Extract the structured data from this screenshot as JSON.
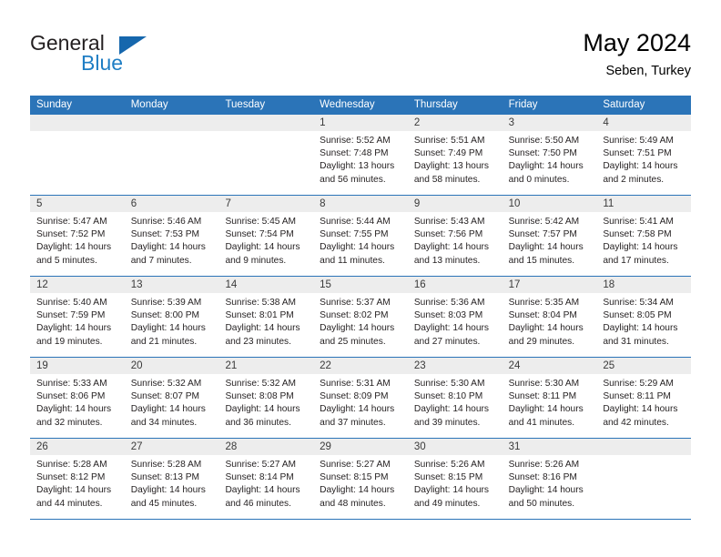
{
  "brand": {
    "word1": "General",
    "word2": "Blue",
    "logo_icon": "triangle-logo-icon",
    "accent_color": "#1f7ec4"
  },
  "header": {
    "title": "May 2024",
    "subtitle": "Seben, Turkey"
  },
  "theme": {
    "header_blue": "#2b74b8",
    "day_number_band": "#ededed",
    "text": "#231f20"
  },
  "weekdays": [
    "Sunday",
    "Monday",
    "Tuesday",
    "Wednesday",
    "Thursday",
    "Friday",
    "Saturday"
  ],
  "weeks": [
    [
      {
        "day": "",
        "sunrise": "",
        "sunset": "",
        "daylight1": "",
        "daylight2": ""
      },
      {
        "day": "",
        "sunrise": "",
        "sunset": "",
        "daylight1": "",
        "daylight2": ""
      },
      {
        "day": "",
        "sunrise": "",
        "sunset": "",
        "daylight1": "",
        "daylight2": ""
      },
      {
        "day": "1",
        "sunrise": "Sunrise: 5:52 AM",
        "sunset": "Sunset: 7:48 PM",
        "daylight1": "Daylight: 13 hours",
        "daylight2": "and 56 minutes."
      },
      {
        "day": "2",
        "sunrise": "Sunrise: 5:51 AM",
        "sunset": "Sunset: 7:49 PM",
        "daylight1": "Daylight: 13 hours",
        "daylight2": "and 58 minutes."
      },
      {
        "day": "3",
        "sunrise": "Sunrise: 5:50 AM",
        "sunset": "Sunset: 7:50 PM",
        "daylight1": "Daylight: 14 hours",
        "daylight2": "and 0 minutes."
      },
      {
        "day": "4",
        "sunrise": "Sunrise: 5:49 AM",
        "sunset": "Sunset: 7:51 PM",
        "daylight1": "Daylight: 14 hours",
        "daylight2": "and 2 minutes."
      }
    ],
    [
      {
        "day": "5",
        "sunrise": "Sunrise: 5:47 AM",
        "sunset": "Sunset: 7:52 PM",
        "daylight1": "Daylight: 14 hours",
        "daylight2": "and 5 minutes."
      },
      {
        "day": "6",
        "sunrise": "Sunrise: 5:46 AM",
        "sunset": "Sunset: 7:53 PM",
        "daylight1": "Daylight: 14 hours",
        "daylight2": "and 7 minutes."
      },
      {
        "day": "7",
        "sunrise": "Sunrise: 5:45 AM",
        "sunset": "Sunset: 7:54 PM",
        "daylight1": "Daylight: 14 hours",
        "daylight2": "and 9 minutes."
      },
      {
        "day": "8",
        "sunrise": "Sunrise: 5:44 AM",
        "sunset": "Sunset: 7:55 PM",
        "daylight1": "Daylight: 14 hours",
        "daylight2": "and 11 minutes."
      },
      {
        "day": "9",
        "sunrise": "Sunrise: 5:43 AM",
        "sunset": "Sunset: 7:56 PM",
        "daylight1": "Daylight: 14 hours",
        "daylight2": "and 13 minutes."
      },
      {
        "day": "10",
        "sunrise": "Sunrise: 5:42 AM",
        "sunset": "Sunset: 7:57 PM",
        "daylight1": "Daylight: 14 hours",
        "daylight2": "and 15 minutes."
      },
      {
        "day": "11",
        "sunrise": "Sunrise: 5:41 AM",
        "sunset": "Sunset: 7:58 PM",
        "daylight1": "Daylight: 14 hours",
        "daylight2": "and 17 minutes."
      }
    ],
    [
      {
        "day": "12",
        "sunrise": "Sunrise: 5:40 AM",
        "sunset": "Sunset: 7:59 PM",
        "daylight1": "Daylight: 14 hours",
        "daylight2": "and 19 minutes."
      },
      {
        "day": "13",
        "sunrise": "Sunrise: 5:39 AM",
        "sunset": "Sunset: 8:00 PM",
        "daylight1": "Daylight: 14 hours",
        "daylight2": "and 21 minutes."
      },
      {
        "day": "14",
        "sunrise": "Sunrise: 5:38 AM",
        "sunset": "Sunset: 8:01 PM",
        "daylight1": "Daylight: 14 hours",
        "daylight2": "and 23 minutes."
      },
      {
        "day": "15",
        "sunrise": "Sunrise: 5:37 AM",
        "sunset": "Sunset: 8:02 PM",
        "daylight1": "Daylight: 14 hours",
        "daylight2": "and 25 minutes."
      },
      {
        "day": "16",
        "sunrise": "Sunrise: 5:36 AM",
        "sunset": "Sunset: 8:03 PM",
        "daylight1": "Daylight: 14 hours",
        "daylight2": "and 27 minutes."
      },
      {
        "day": "17",
        "sunrise": "Sunrise: 5:35 AM",
        "sunset": "Sunset: 8:04 PM",
        "daylight1": "Daylight: 14 hours",
        "daylight2": "and 29 minutes."
      },
      {
        "day": "18",
        "sunrise": "Sunrise: 5:34 AM",
        "sunset": "Sunset: 8:05 PM",
        "daylight1": "Daylight: 14 hours",
        "daylight2": "and 31 minutes."
      }
    ],
    [
      {
        "day": "19",
        "sunrise": "Sunrise: 5:33 AM",
        "sunset": "Sunset: 8:06 PM",
        "daylight1": "Daylight: 14 hours",
        "daylight2": "and 32 minutes."
      },
      {
        "day": "20",
        "sunrise": "Sunrise: 5:32 AM",
        "sunset": "Sunset: 8:07 PM",
        "daylight1": "Daylight: 14 hours",
        "daylight2": "and 34 minutes."
      },
      {
        "day": "21",
        "sunrise": "Sunrise: 5:32 AM",
        "sunset": "Sunset: 8:08 PM",
        "daylight1": "Daylight: 14 hours",
        "daylight2": "and 36 minutes."
      },
      {
        "day": "22",
        "sunrise": "Sunrise: 5:31 AM",
        "sunset": "Sunset: 8:09 PM",
        "daylight1": "Daylight: 14 hours",
        "daylight2": "and 37 minutes."
      },
      {
        "day": "23",
        "sunrise": "Sunrise: 5:30 AM",
        "sunset": "Sunset: 8:10 PM",
        "daylight1": "Daylight: 14 hours",
        "daylight2": "and 39 minutes."
      },
      {
        "day": "24",
        "sunrise": "Sunrise: 5:30 AM",
        "sunset": "Sunset: 8:11 PM",
        "daylight1": "Daylight: 14 hours",
        "daylight2": "and 41 minutes."
      },
      {
        "day": "25",
        "sunrise": "Sunrise: 5:29 AM",
        "sunset": "Sunset: 8:11 PM",
        "daylight1": "Daylight: 14 hours",
        "daylight2": "and 42 minutes."
      }
    ],
    [
      {
        "day": "26",
        "sunrise": "Sunrise: 5:28 AM",
        "sunset": "Sunset: 8:12 PM",
        "daylight1": "Daylight: 14 hours",
        "daylight2": "and 44 minutes."
      },
      {
        "day": "27",
        "sunrise": "Sunrise: 5:28 AM",
        "sunset": "Sunset: 8:13 PM",
        "daylight1": "Daylight: 14 hours",
        "daylight2": "and 45 minutes."
      },
      {
        "day": "28",
        "sunrise": "Sunrise: 5:27 AM",
        "sunset": "Sunset: 8:14 PM",
        "daylight1": "Daylight: 14 hours",
        "daylight2": "and 46 minutes."
      },
      {
        "day": "29",
        "sunrise": "Sunrise: 5:27 AM",
        "sunset": "Sunset: 8:15 PM",
        "daylight1": "Daylight: 14 hours",
        "daylight2": "and 48 minutes."
      },
      {
        "day": "30",
        "sunrise": "Sunrise: 5:26 AM",
        "sunset": "Sunset: 8:15 PM",
        "daylight1": "Daylight: 14 hours",
        "daylight2": "and 49 minutes."
      },
      {
        "day": "31",
        "sunrise": "Sunrise: 5:26 AM",
        "sunset": "Sunset: 8:16 PM",
        "daylight1": "Daylight: 14 hours",
        "daylight2": "and 50 minutes."
      },
      {
        "day": "",
        "sunrise": "",
        "sunset": "",
        "daylight1": "",
        "daylight2": ""
      }
    ]
  ]
}
